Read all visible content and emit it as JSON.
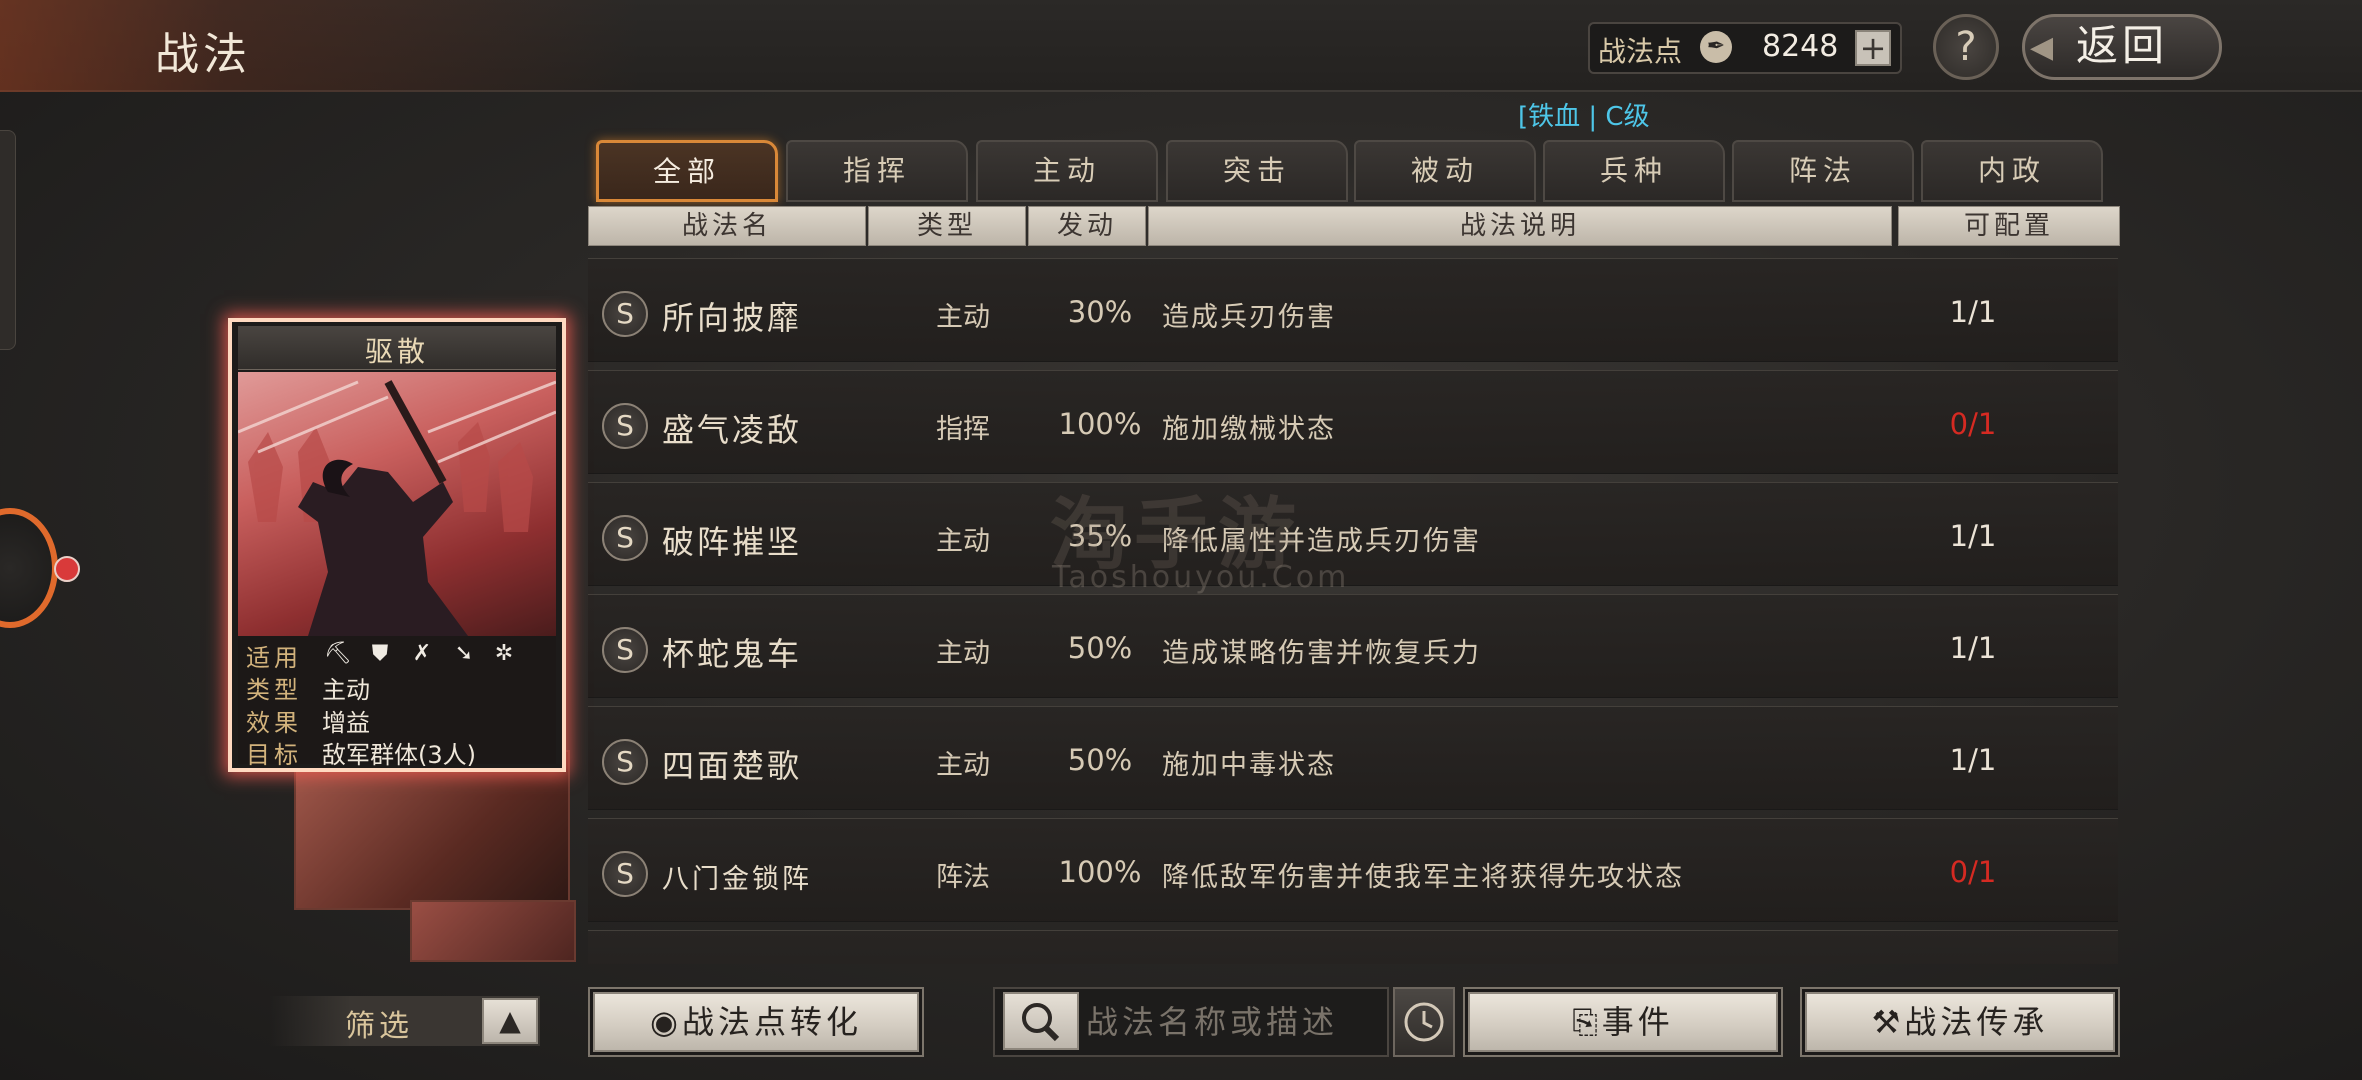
{
  "header": {
    "title": "战法",
    "points_label": "战法点",
    "points_value": "8248",
    "plus_label": "+",
    "help_label": "?",
    "back_label": "返回"
  },
  "sort_hint": "[铁血 | C级",
  "tabs": [
    {
      "label": "全部",
      "active": true
    },
    {
      "label": "指挥"
    },
    {
      "label": "主动"
    },
    {
      "label": "突击"
    },
    {
      "label": "被动"
    },
    {
      "label": "兵种"
    },
    {
      "label": "阵法"
    },
    {
      "label": "内政"
    }
  ],
  "columns": [
    "战法名",
    "类型",
    "发动",
    "战法说明",
    "可配置"
  ],
  "rows": [
    {
      "grade": "S",
      "name": "所向披靡",
      "type": "主动",
      "rate": "30%",
      "desc": "造成兵刃伤害",
      "config": "1/1",
      "config_color": "#ebe3d6"
    },
    {
      "grade": "S",
      "name": "盛气凌敌",
      "type": "指挥",
      "rate": "100%",
      "desc": "施加缴械状态",
      "config": "0/1",
      "config_color": "#d52a22"
    },
    {
      "grade": "S",
      "name": "破阵摧坚",
      "type": "主动",
      "rate": "35%",
      "desc": "降低属性并造成兵刃伤害",
      "config": "1/1",
      "config_color": "#ebe3d6"
    },
    {
      "grade": "S",
      "name": "杯蛇鬼车",
      "type": "主动",
      "rate": "50%",
      "desc": "造成谋略伤害并恢复兵力",
      "config": "1/1",
      "config_color": "#ebe3d6"
    },
    {
      "grade": "S",
      "name": "四面楚歌",
      "type": "主动",
      "rate": "50%",
      "desc": "施加中毒状态",
      "config": "1/1",
      "config_color": "#ebe3d6"
    },
    {
      "grade": "S",
      "name": "八门金锁阵",
      "type": "阵法",
      "rate": "100%",
      "desc": "降低敌军伤害并使我军主将获得先攻状态",
      "config": "0/1",
      "config_color": "#d52a22"
    }
  ],
  "watermark": {
    "main": "淘手游",
    "sub": "Taoshouyou.Com"
  },
  "card": {
    "name": "驱散",
    "applies_label": "适用",
    "unit_icons": [
      "cavalry-icon",
      "shield-icon",
      "bow-icon",
      "spear-icon",
      "wheel-icon"
    ],
    "type_label": "类型",
    "type_value": "主动",
    "effect_label": "效果",
    "effect_value": "增益",
    "target_label": "目标",
    "target_value": "敌军群体(3人)"
  },
  "bottom": {
    "filter_label": "筛选",
    "convert_label": "战法点转化",
    "search_placeholder": "战法名称或描述",
    "events_label": "事件",
    "inherit_label": "战法传承"
  },
  "colors": {
    "accent": "#d98838",
    "alert": "#d52a22",
    "highlight": "#4ec6e8"
  }
}
